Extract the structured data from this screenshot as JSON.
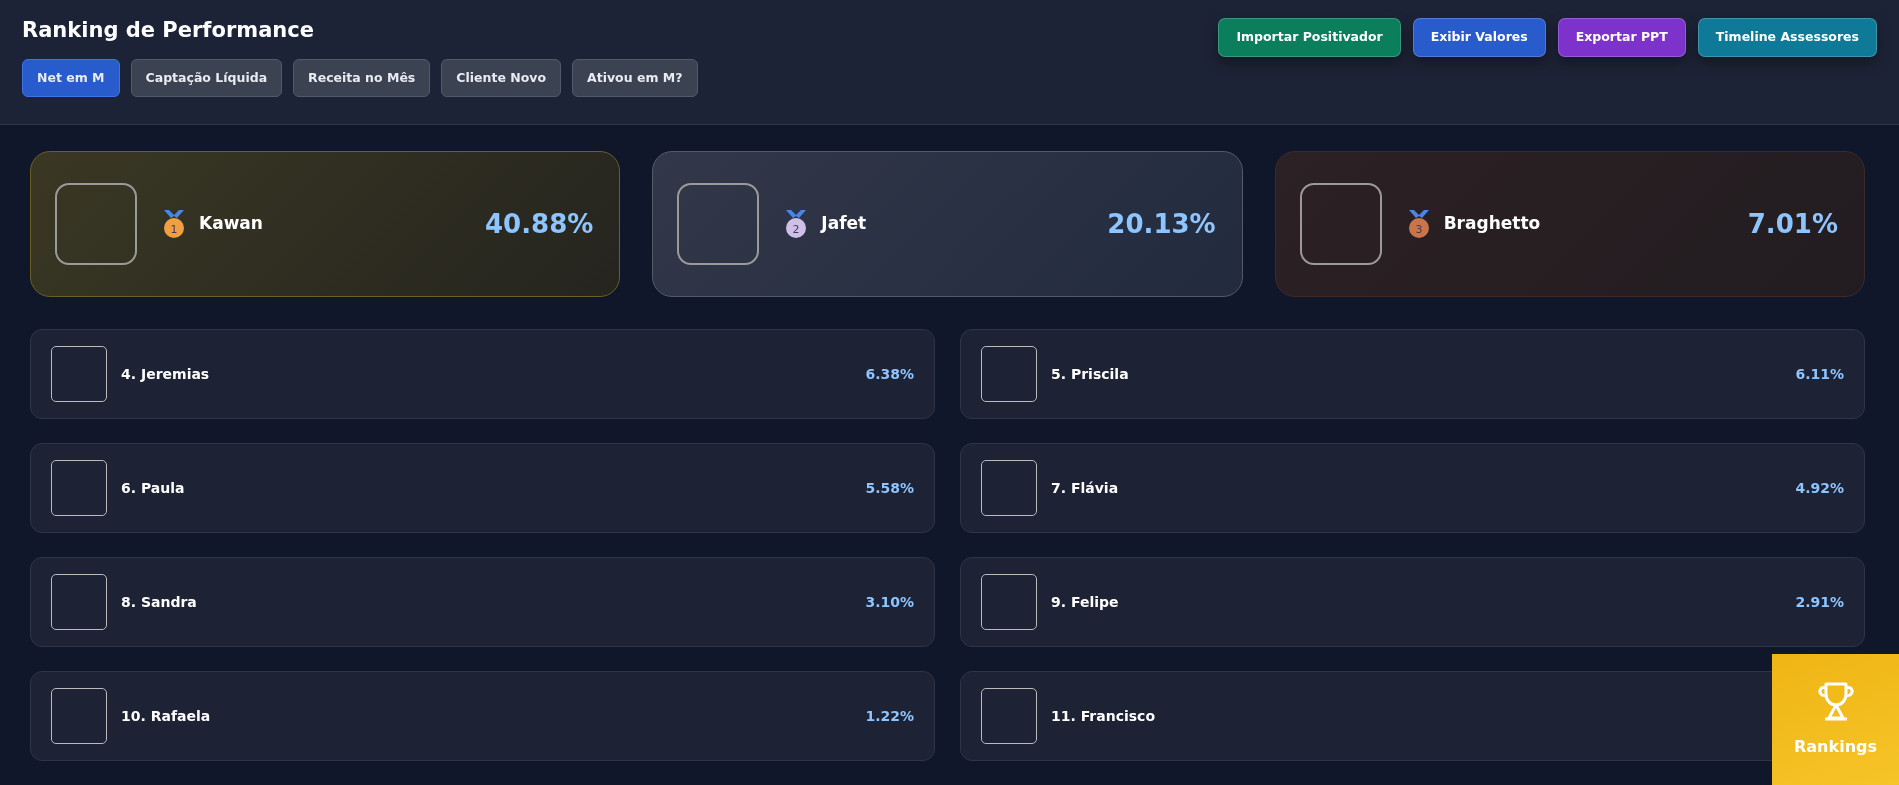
{
  "title": "Ranking de Performance",
  "tabs": [
    {
      "label": "Net em M",
      "selected": true
    },
    {
      "label": "Captação Líquida",
      "selected": false
    },
    {
      "label": "Receita no Mês",
      "selected": false
    },
    {
      "label": "Cliente Novo",
      "selected": false
    },
    {
      "label": "Ativou em M?",
      "selected": false
    }
  ],
  "actions": [
    {
      "label": "Importar Positivador",
      "color": "#0b7f5c"
    },
    {
      "label": "Exibir Valores",
      "color": "#285bcc"
    },
    {
      "label": "Exportar PPT",
      "color": "#7e32cc"
    },
    {
      "label": "Timeline Assessores",
      "color": "#0e7a98"
    }
  ],
  "podium": [
    {
      "medal": "1",
      "color": "#f0a040",
      "name": "Kawan",
      "value": "40.88%"
    },
    {
      "medal": "2",
      "color": "#cfc0ea",
      "name": "Jafet",
      "value": "20.13%"
    },
    {
      "medal": "3",
      "color": "#c8754a",
      "name": "Braghetto",
      "value": "7.01%"
    }
  ],
  "ranking": [
    {
      "name": "4. Jeremias",
      "value": "6.38%"
    },
    {
      "name": "5. Priscila",
      "value": "6.11%"
    },
    {
      "name": "6. Paula",
      "value": "5.58%"
    },
    {
      "name": "7. Flávia",
      "value": "4.92%"
    },
    {
      "name": "8. Sandra",
      "value": "3.10%"
    },
    {
      "name": "9. Felipe",
      "value": "2.91%"
    },
    {
      "name": "10. Rafaela",
      "value": "1.22%"
    },
    {
      "name": "11. Francisco"
    }
  ],
  "rankings_button": {
    "label": "Rankings"
  }
}
